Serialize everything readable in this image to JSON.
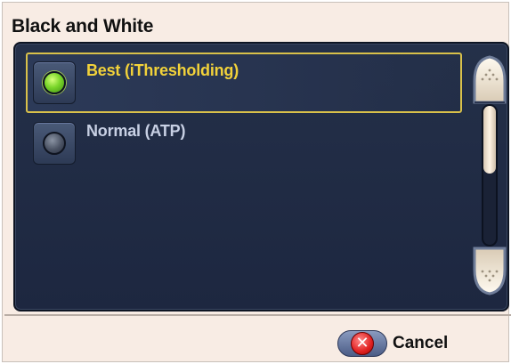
{
  "dialog": {
    "title": "Black and White"
  },
  "options": [
    {
      "label": "Best (iThresholding)",
      "selected": true
    },
    {
      "label": "Normal (ATP)",
      "selected": false
    }
  ],
  "scrollbar": {
    "up_icon": "scroll-up-arrow-icon",
    "down_icon": "scroll-down-arrow-icon"
  },
  "footer": {
    "cancel_label": "Cancel",
    "cancel_icon": "red-x-icon"
  },
  "colors": {
    "panel_bg": "#243049",
    "selected_text": "#f2d23a",
    "normal_text": "#c8d0e4",
    "selected_border": "#d9c14a",
    "radio_on": "#7ad62a",
    "background": "#f8ece4"
  }
}
